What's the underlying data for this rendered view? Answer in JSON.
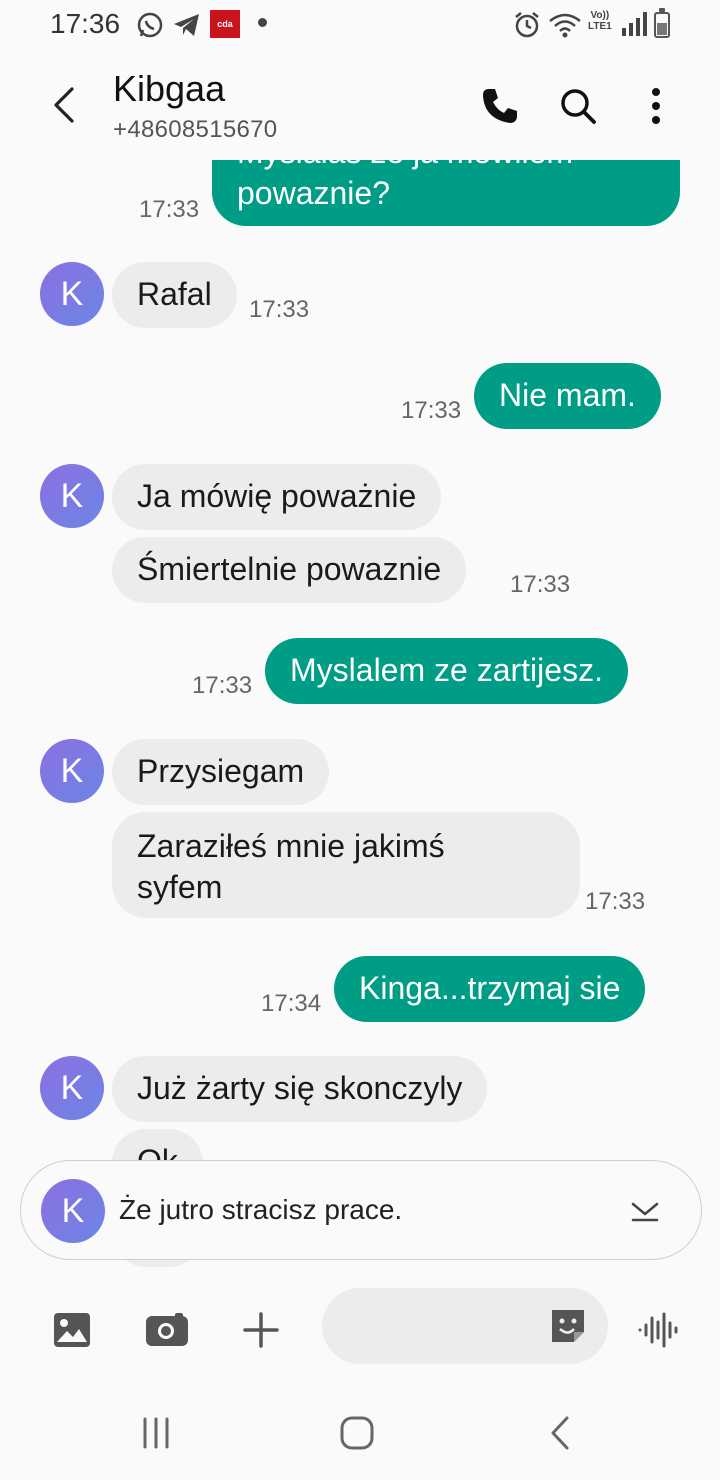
{
  "status_bar": {
    "time": "17:36",
    "app_badge": "cda",
    "network_label_1": "Vo))",
    "network_label_2": "LTE1"
  },
  "header": {
    "contact_name": "Kibgaa",
    "contact_number": "+48608515670"
  },
  "messages": {
    "m0": {
      "direction": "out",
      "text": "Myslałaś że ja mówiłem powaznie?",
      "line1": "Myslalas ze ja mowilem",
      "line2": "powaznie?",
      "time": "17:33"
    },
    "m1": {
      "direction": "in",
      "avatar": "K",
      "text": "Rafal",
      "time": "17:33"
    },
    "m2": {
      "direction": "out",
      "text": "Nie mam.",
      "time": "17:33"
    },
    "m3": {
      "direction": "in",
      "avatar": "K",
      "text": "Ja mówię poważnie"
    },
    "m4": {
      "direction": "in",
      "text": "Śmiertelnie powaznie",
      "time": "17:33"
    },
    "m5": {
      "direction": "out",
      "text": "Myslalem ze zartijesz.",
      "time": "17:33"
    },
    "m6": {
      "direction": "in",
      "avatar": "K",
      "text": "Przysiegam"
    },
    "m7": {
      "direction": "in",
      "line1": "Zaraziłeś mnie jakimś",
      "line2": "syfem",
      "time": "17:33"
    },
    "m8": {
      "direction": "out",
      "text": "Kinga...trzymaj sie",
      "time": "17:34"
    },
    "m9": {
      "direction": "in",
      "avatar": "K",
      "text": "Już żarty się skonczyly"
    },
    "m10": {
      "direction": "in",
      "text": "Ok"
    }
  },
  "preview": {
    "avatar": "K",
    "text": "Że jutro stracisz prace."
  },
  "composer": {
    "placeholder": ""
  },
  "colors": {
    "outgoing_bubble": "#009d86",
    "incoming_bubble": "#ececec",
    "avatar_gradient_start": "#8d6fe0",
    "avatar_gradient_end": "#6a86e6",
    "background": "#fafafa"
  },
  "icons": {
    "back": "arrow-left-icon",
    "call": "phone-icon",
    "search": "search-icon",
    "menu": "more-vertical-icon",
    "gallery": "image-icon",
    "camera": "camera-icon",
    "add": "plus-icon",
    "sticker": "sticker-icon",
    "voice": "voice-wave-icon",
    "expand": "chevron-down-icon",
    "recents": "recents-icon",
    "home": "home-icon",
    "nav_back": "nav-back-icon"
  }
}
